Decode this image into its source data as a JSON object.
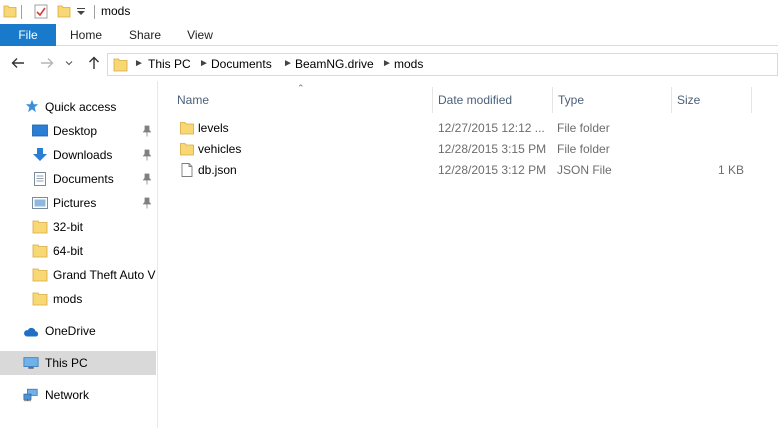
{
  "window": {
    "title": "mods"
  },
  "ribbon": {
    "tabs": [
      "File",
      "Home",
      "Share",
      "View"
    ]
  },
  "address": {
    "crumbs": [
      "This PC",
      "Documents",
      "BeamNG.drive",
      "mods"
    ]
  },
  "nav": {
    "quick_access": "Quick access",
    "items": [
      {
        "label": "Desktop",
        "pinned": true,
        "icon": "desktop-icon"
      },
      {
        "label": "Downloads",
        "pinned": true,
        "icon": "downloads-icon"
      },
      {
        "label": "Documents",
        "pinned": true,
        "icon": "documents-icon"
      },
      {
        "label": "Pictures",
        "pinned": true,
        "icon": "pictures-icon"
      },
      {
        "label": "32-bit",
        "pinned": false,
        "icon": "folder-icon"
      },
      {
        "label": "64-bit",
        "pinned": false,
        "icon": "folder-icon"
      },
      {
        "label": "Grand Theft Auto V",
        "pinned": false,
        "icon": "folder-icon"
      },
      {
        "label": "mods",
        "pinned": false,
        "icon": "folder-icon"
      }
    ],
    "onedrive": "OneDrive",
    "this_pc": "This PC",
    "network": "Network"
  },
  "list": {
    "columns": [
      "Name",
      "Date modified",
      "Type",
      "Size"
    ],
    "rows": [
      {
        "name": "levels",
        "date": "12/27/2015 12:12 ...",
        "type": "File folder",
        "size": "",
        "icon": "folder-icon"
      },
      {
        "name": "vehicles",
        "date": "12/28/2015 3:15 PM",
        "type": "File folder",
        "size": "",
        "icon": "folder-icon"
      },
      {
        "name": "db.json",
        "date": "12/28/2015 3:12 PM",
        "type": "JSON File",
        "size": "1 KB",
        "icon": "file-icon"
      }
    ]
  },
  "colors": {
    "accent": "#1979ca",
    "folder": "#f8d775",
    "selected": "#d9d9d9",
    "header_text": "#4c607a"
  }
}
